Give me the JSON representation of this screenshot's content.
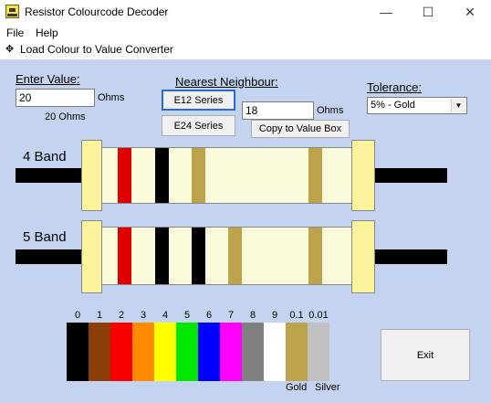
{
  "window": {
    "title": "Resistor Colourcode Decoder",
    "minimize_glyph": "—",
    "maximize_glyph": "☐",
    "close_glyph": "✕"
  },
  "menu": {
    "file": "File",
    "help": "Help"
  },
  "toolbar": {
    "plus_glyph": "✥",
    "load_label": "Load Colour to Value Converter"
  },
  "enter_value": {
    "label": "Enter Value:",
    "value": "20",
    "unit": "Ohms",
    "display": "20 Ohms"
  },
  "nearest": {
    "label": "Nearest Neighbour:",
    "e12_label": "E12 Series",
    "e24_label": "E24 Series",
    "value": "18",
    "unit": "Ohms",
    "copy_label": "Copy to Value Box"
  },
  "tolerance": {
    "label": "Tolerance:",
    "selected": "5% - Gold",
    "arrow_glyph": "▼"
  },
  "resistors": {
    "four_band_label": "4 Band",
    "four_band_colors": [
      "#e00000",
      "#000000",
      "#bca34c",
      "#bca34c"
    ],
    "five_band_label": "5 Band",
    "five_band_colors": [
      "#e00000",
      "#000000",
      "#000000",
      "#bca34c",
      "#bca34c"
    ],
    "body_color": "#fcfcdc",
    "cap_color": "#fcf49c"
  },
  "palette": {
    "numbers": [
      "0",
      "1",
      "2",
      "3",
      "4",
      "5",
      "6",
      "7",
      "8",
      "9",
      "0.1",
      "0.01"
    ],
    "colors": [
      "#000000",
      "#8b3e06",
      "#f80000",
      "#ff8c00",
      "#ffff00",
      "#00e800",
      "#0000ff",
      "#ff00ff",
      "#808080",
      "#ffffff",
      "#bca34c",
      "#c0c0c0"
    ],
    "gold_label": "Gold",
    "silver_label": "Silver"
  },
  "exit_label": "Exit"
}
